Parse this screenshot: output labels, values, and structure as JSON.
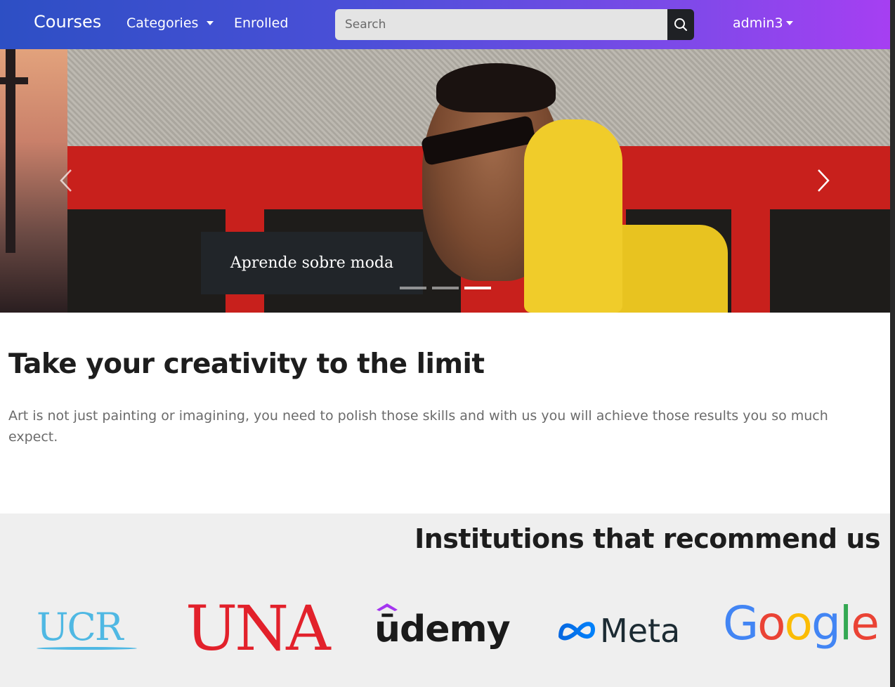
{
  "navbar": {
    "brand": "Courses",
    "categories_label": "Categories",
    "enrolled_label": "Enrolled",
    "search_placeholder": "Search",
    "user_label": "admin3"
  },
  "carousel": {
    "caption": "Aprende sobre moda",
    "indicators": 3,
    "active_indicator": 3
  },
  "hero": {
    "title": "Take your creativity to the limit",
    "text": "Art is not just painting or imagining, you need to polish those skills and with us you will achieve those results you so much expect."
  },
  "institutions": {
    "title": "Institutions that recommend us",
    "logos": {
      "ucr": "UCR",
      "una": "UNA",
      "udemy": "ūdemy",
      "meta": "Meta",
      "google": [
        "G",
        "o",
        "o",
        "g",
        "l",
        "e"
      ]
    }
  },
  "colors": {
    "nav_gradient_start": "#2d4fc4",
    "nav_gradient_end": "#a63ff2",
    "caption_bg": "#212529",
    "section_bg": "#efefef"
  },
  "icons": {
    "search": "search-icon",
    "caret": "caret-down-icon",
    "prev": "chevron-left-icon",
    "next": "chevron-right-icon"
  }
}
